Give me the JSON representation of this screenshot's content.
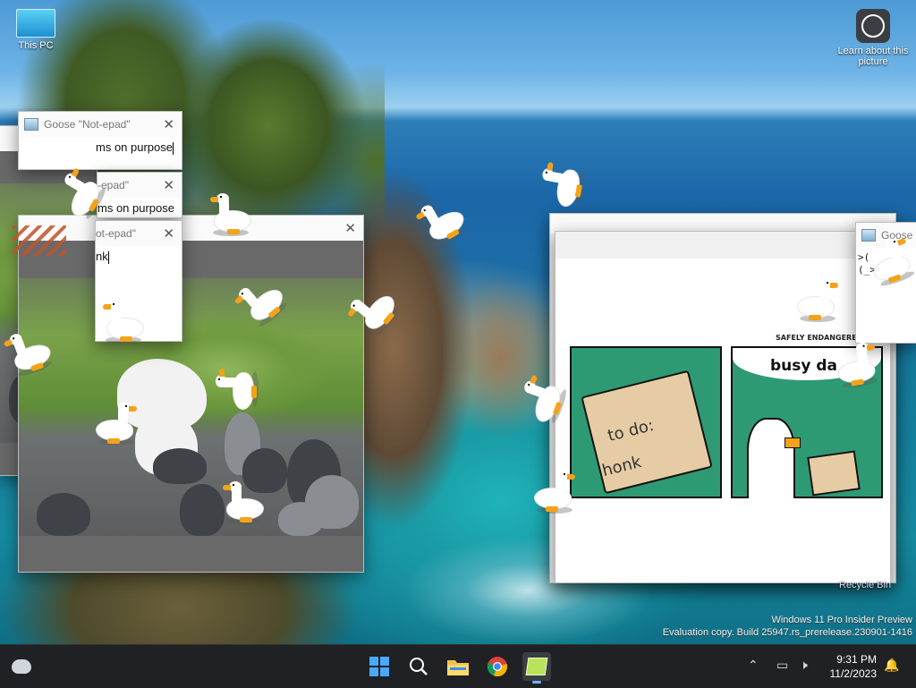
{
  "desktop": {
    "icons": [
      {
        "label": "This PC"
      },
      {
        "label": "Learn about this picture"
      }
    ],
    "recycle_bin_label": "Recycle Bin",
    "watermark_line1": "Windows 11 Pro Insider Preview",
    "watermark_line2": "Evaluation copy. Build 25947.rs_prerelease.230901-1416"
  },
  "windows": {
    "notepad1": {
      "title": "Goose \"Not-epad\"",
      "text": "ms on purpose"
    },
    "notepad2": {
      "title": "-epad\"",
      "text": "ms on purpose"
    },
    "notepad3": {
      "title": "ot-epad\"",
      "text": "nk"
    },
    "right_note": {
      "title": "Goose",
      "text_line1": ">(",
      "text_line2": "(_>"
    }
  },
  "comic": {
    "header": "SAFELY ENDANGERED",
    "panel1_text_line1": "to do:",
    "panel1_text_line2": "honk",
    "panel2_text": "busy da"
  },
  "taskbar": {
    "time": "9:31 PM",
    "date": "11/2/2023",
    "items": [
      "widgets",
      "start",
      "search",
      "file-explorer",
      "chrome",
      "goose-notepad"
    ]
  },
  "colors": {
    "taskbar_bg": "#1f2124",
    "accent": "#6fb3ff",
    "beak": "#f2a31a",
    "comic_green": "#2d9a74"
  }
}
